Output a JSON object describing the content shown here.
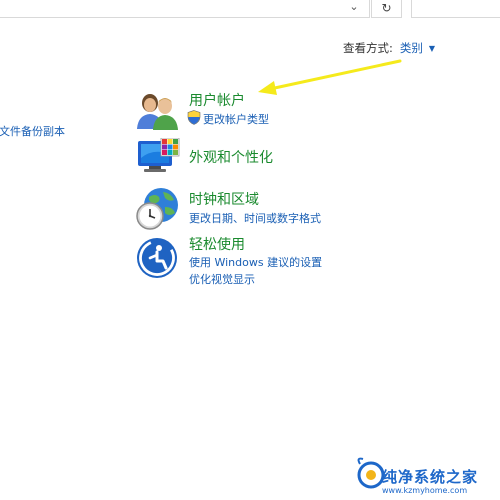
{
  "toolbar": {
    "chevron_glyph": "⌄",
    "refresh_glyph": "↻"
  },
  "view_by": {
    "label": "查看方式:",
    "value": "类别"
  },
  "sidebar": {
    "link_text": "文件备份副本"
  },
  "categories": [
    {
      "title": "用户帐户",
      "icon": "users-icon",
      "links": [
        "更改帐户类型"
      ]
    },
    {
      "title": "外观和个性化",
      "icon": "appearance-icon",
      "links": []
    },
    {
      "title": "时钟和区域",
      "icon": "clock-region-icon",
      "links": [
        "更改日期、时间或数字格式"
      ]
    },
    {
      "title": "轻松使用",
      "icon": "ease-of-access-icon",
      "links": [
        "使用 Windows 建议的设置",
        "优化视觉显示"
      ]
    }
  ],
  "colors": {
    "category_title": "#1a8a2e",
    "link": "#1a5fb4",
    "annotation_arrow": "#f5ea1c"
  },
  "watermark": {
    "title": "纯净系统之家",
    "url": "www.kzmyhome.com"
  }
}
